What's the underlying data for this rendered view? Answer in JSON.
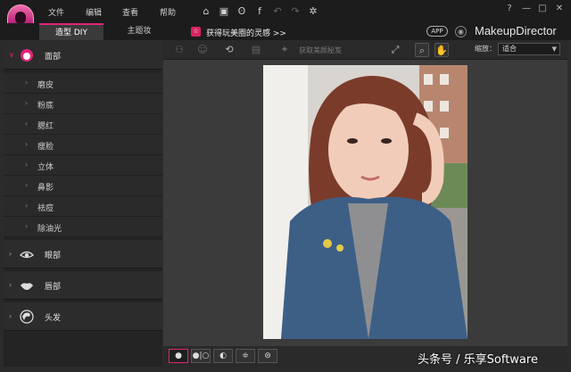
{
  "menu": {
    "file": "文件",
    "edit": "编辑",
    "view": "查看",
    "help": "帮助"
  },
  "icons": {
    "home": "home-icon",
    "save": "save-icon",
    "weibo": "weibo-icon",
    "facebook": "facebook-icon",
    "undo": "undo-icon",
    "redo": "redo-icon",
    "settings": "gear-icon"
  },
  "window": {
    "help": "?",
    "minimize": "—",
    "maximize": "□",
    "close": "✕"
  },
  "tabs": [
    {
      "label": "造型 DIY",
      "active": true
    },
    {
      "label": "主题妆",
      "active": false
    }
  ],
  "banner": {
    "text": "获得玩美圈的灵感 >>"
  },
  "brand": {
    "app_badge": "APP",
    "name": "MakeupDirector"
  },
  "sidebar": {
    "categories": [
      {
        "label": "面部",
        "icon": "face-icon",
        "open": true
      },
      {
        "label": "眼部",
        "icon": "eye-icon",
        "open": false
      },
      {
        "label": "唇部",
        "icon": "lips-icon",
        "open": false
      },
      {
        "label": "头发",
        "icon": "hair-icon",
        "open": false
      }
    ],
    "face_items": [
      "磨皮",
      "粉底",
      "腮红",
      "瘦脸",
      "立体",
      "鼻影",
      "祛痘",
      "除油光"
    ]
  },
  "toolbar": {
    "get_makeup_secret": "获取美颜秘笈",
    "zoom_label": "缩放：",
    "zoom_value": "适合"
  },
  "watermark": "头条号 / 乐享Software",
  "colors": {
    "accent": "#e2247a",
    "bg": "#2b2b2b"
  }
}
